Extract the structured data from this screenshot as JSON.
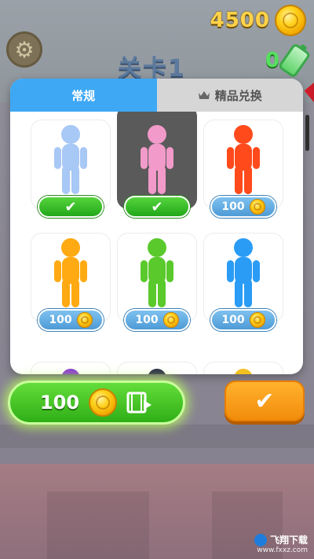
{
  "hud": {
    "coins": "4500",
    "level_title": "关卡1",
    "energy": "0",
    "icons": {
      "settings": "gear-icon",
      "coin": "coin-icon",
      "energy": "battery-icon"
    }
  },
  "shop": {
    "tabs": [
      {
        "label": "常规",
        "active": true
      },
      {
        "label": "精品兑换",
        "active": false,
        "icon": "crown-icon"
      }
    ],
    "skins": [
      {
        "color": "#a8c8f5",
        "state": "owned"
      },
      {
        "color": "#f29ac9",
        "state": "owned",
        "selected": true
      },
      {
        "color": "#ff4a1c",
        "state": "price",
        "price": "100"
      },
      {
        "color": "#ffaa12",
        "state": "price",
        "price": "100"
      },
      {
        "color": "#5ac92c",
        "state": "price",
        "price": "100"
      },
      {
        "color": "#2a9cf5",
        "state": "price",
        "price": "100"
      }
    ],
    "partial_skin_colors": [
      "#8a3ad0",
      "#2b2b4a",
      "#f0c020"
    ]
  },
  "bottom": {
    "ad_button": {
      "amount": "100",
      "icons": [
        "coin-icon",
        "video-ad-icon"
      ]
    },
    "confirm_icon": "✔"
  },
  "watermark": {
    "brand": "飞翔下载",
    "url": "www.fxxz.com"
  },
  "colors": {
    "tab_active": "#3ea8f5",
    "owned_badge": "#2fb51f",
    "price_badge": "#5aa5dd",
    "confirm": "#f59a14"
  }
}
